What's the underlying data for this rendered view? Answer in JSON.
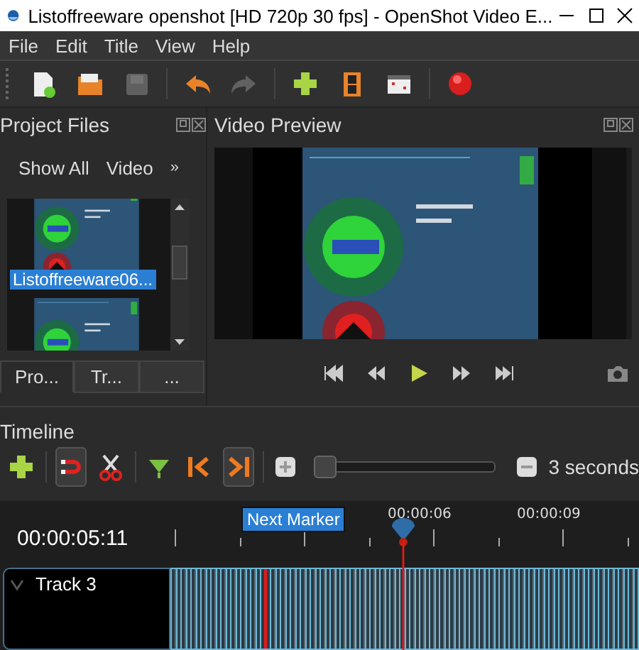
{
  "window": {
    "title": "Listoffreeware openshot [HD 720p 30 fps] - OpenShot Video E..."
  },
  "menu": [
    "File",
    "Edit",
    "Title",
    "View",
    "Help"
  ],
  "toolbar": [
    {
      "kind": "new"
    },
    {
      "kind": "open"
    },
    {
      "kind": "save",
      "disabled": true
    },
    {
      "kind": "sep"
    },
    {
      "kind": "undo"
    },
    {
      "kind": "redo",
      "disabled": true
    },
    {
      "kind": "sep"
    },
    {
      "kind": "add"
    },
    {
      "kind": "film"
    },
    {
      "kind": "export"
    },
    {
      "kind": "sep"
    },
    {
      "kind": "record"
    }
  ],
  "project_files": {
    "title": "Project Files",
    "filters": [
      "Show All",
      "Video"
    ],
    "more": "»",
    "files": [
      {
        "name": "Listoffreeware06...",
        "selected": true
      },
      {
        "selected": false
      }
    ],
    "tabs": [
      {
        "label": "Pro...",
        "selected": true
      },
      {
        "label": "Tr...",
        "selected": false
      },
      {
        "label": "...",
        "selected": false
      }
    ]
  },
  "video_preview": {
    "title": "Video Preview"
  },
  "timeline": {
    "title": "Timeline",
    "tools": [
      {
        "kind": "add",
        "active": false
      },
      {
        "kind": "sep"
      },
      {
        "kind": "snap",
        "active": true
      },
      {
        "kind": "razor",
        "active": false
      },
      {
        "kind": "sep"
      },
      {
        "kind": "marker",
        "active": false
      },
      {
        "kind": "prev",
        "active": false
      },
      {
        "kind": "next",
        "active": true
      },
      {
        "kind": "sep"
      }
    ],
    "zoom": {
      "level": 0.03,
      "label": "3 seconds"
    },
    "tooltip": "Next Marker",
    "current_time": "00:00:05:11",
    "ruler": [
      "00:00:06",
      "00:00:09"
    ],
    "tracks": [
      {
        "name": "Track 3",
        "expanded": true
      }
    ]
  }
}
